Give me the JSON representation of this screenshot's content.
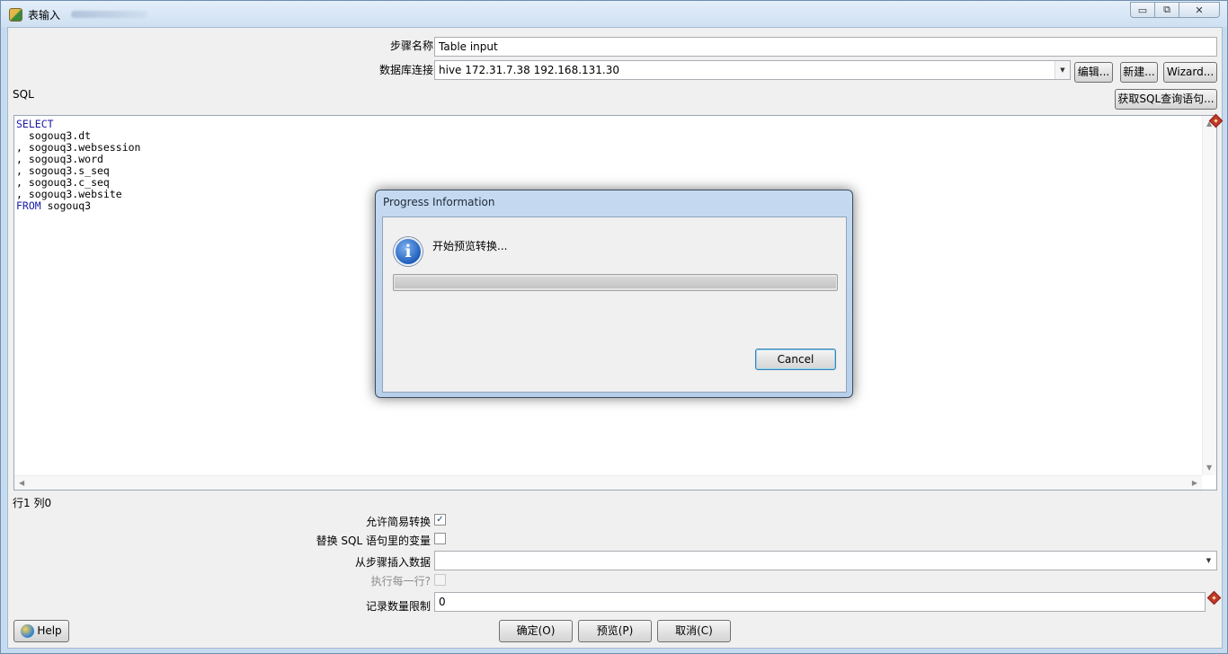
{
  "window": {
    "title": "表输入",
    "controls": {
      "minimize": "▭",
      "restore": "⧉",
      "close": "✕"
    }
  },
  "form": {
    "step_name_label": "步骤名称",
    "step_name_value": "Table input",
    "db_connection_label": "数据库连接",
    "db_connection_value": "hive 172.31.7.38  192.168.131.30",
    "edit_button": "编辑...",
    "new_button": "新建...",
    "wizard_button": "Wizard...",
    "sql_label": "SQL",
    "get_sql_button": "获取SQL查询语句...",
    "sql_lines": [
      {
        "kw": "SELECT",
        "rest": ""
      },
      {
        "kw": "",
        "rest": "  sogouq3.dt"
      },
      {
        "kw": "",
        "rest": ", sogouq3.websession"
      },
      {
        "kw": "",
        "rest": ", sogouq3.word"
      },
      {
        "kw": "",
        "rest": ", sogouq3.s_seq"
      },
      {
        "kw": "",
        "rest": ", sogouq3.c_seq"
      },
      {
        "kw": "",
        "rest": ", sogouq3.website"
      },
      {
        "kw": "FROM",
        "rest": " sogouq3"
      }
    ],
    "cursor_position": "行1 列0",
    "lazy_conversion_label": "允许简易转换",
    "lazy_conversion_checked": true,
    "replace_variables_label": "替换 SQL 语句里的变量",
    "replace_variables_checked": false,
    "insert_from_step_label": "从步骤插入数据",
    "insert_from_step_value": "",
    "execute_each_row_label": "执行每一行?",
    "execute_each_row_checked": false,
    "limit_label": "记录数量限制",
    "limit_value": "0"
  },
  "footer": {
    "help_button": "Help",
    "ok_button": "确定(O)",
    "preview_button": "预览(P)",
    "cancel_button": "取消(C)"
  },
  "dialog": {
    "title": "Progress Information",
    "message": "开始预览转换...",
    "progress": 0,
    "cancel_button": "Cancel"
  }
}
